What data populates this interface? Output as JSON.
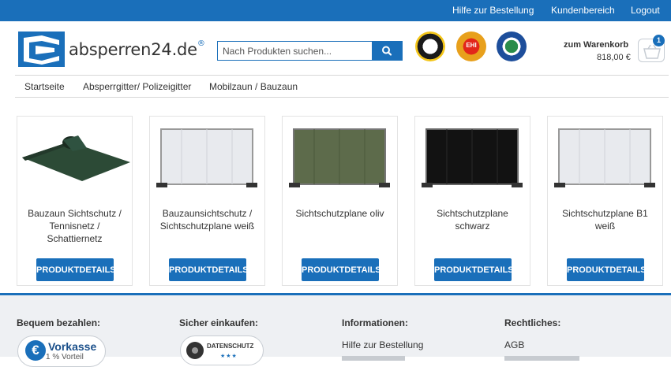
{
  "topbar": {
    "links": [
      "Hilfe zur Bestellung",
      "Kundenbereich",
      "Logout"
    ]
  },
  "header": {
    "logo_text": "absperren24.de",
    "logo_registered": "®",
    "search_placeholder": "Nach Produkten suchen...",
    "seal_2_text": "EHI",
    "cart_label": "zum Warenkorb",
    "cart_total": "818,00 €",
    "cart_count": "1"
  },
  "nav": {
    "items": [
      "Startseite",
      "Absperrgitter/ Polizeigitter",
      "Mobilzaun / Bauzaun"
    ]
  },
  "products": [
    {
      "title": "Bauzaun Sichtschutz / Tennisnetz / Schattiernetz",
      "button": "PRODUKTDETAILS",
      "image": "green-net-roll"
    },
    {
      "title": "Bauzaunsichtschutz / Sichtschutzplane weiß",
      "button": "PRODUKTDETAILS",
      "image": "white-fence-panel"
    },
    {
      "title": "Sichtschutzplane oliv",
      "button": "PRODUKTDETAILS",
      "image": "olive-fence-panel"
    },
    {
      "title": "Sichtschutzplane schwarz",
      "button": "PRODUKTDETAILS",
      "image": "black-fence-panel"
    },
    {
      "title": "Sichtschutzplane B1 weiß",
      "button": "PRODUKTDETAILS",
      "image": "white-fence-panel"
    }
  ],
  "footer": {
    "col1_heading": "Bequem bezahlen:",
    "vorkasse_title": "Vorkasse",
    "vorkasse_sub": "1 % Vorteil",
    "col2_heading": "Sicher einkaufen:",
    "datenschutz_title": "DATENSCHUTZ",
    "datenschutz_stars": "★★★",
    "col3_heading": "Informationen:",
    "col3_link": "Hilfe zur Bestellung",
    "col4_heading": "Rechtliches:",
    "col4_link": "AGB"
  },
  "colors": {
    "brand_blue": "#1a6fba",
    "footer_bg": "#eef0f3"
  }
}
